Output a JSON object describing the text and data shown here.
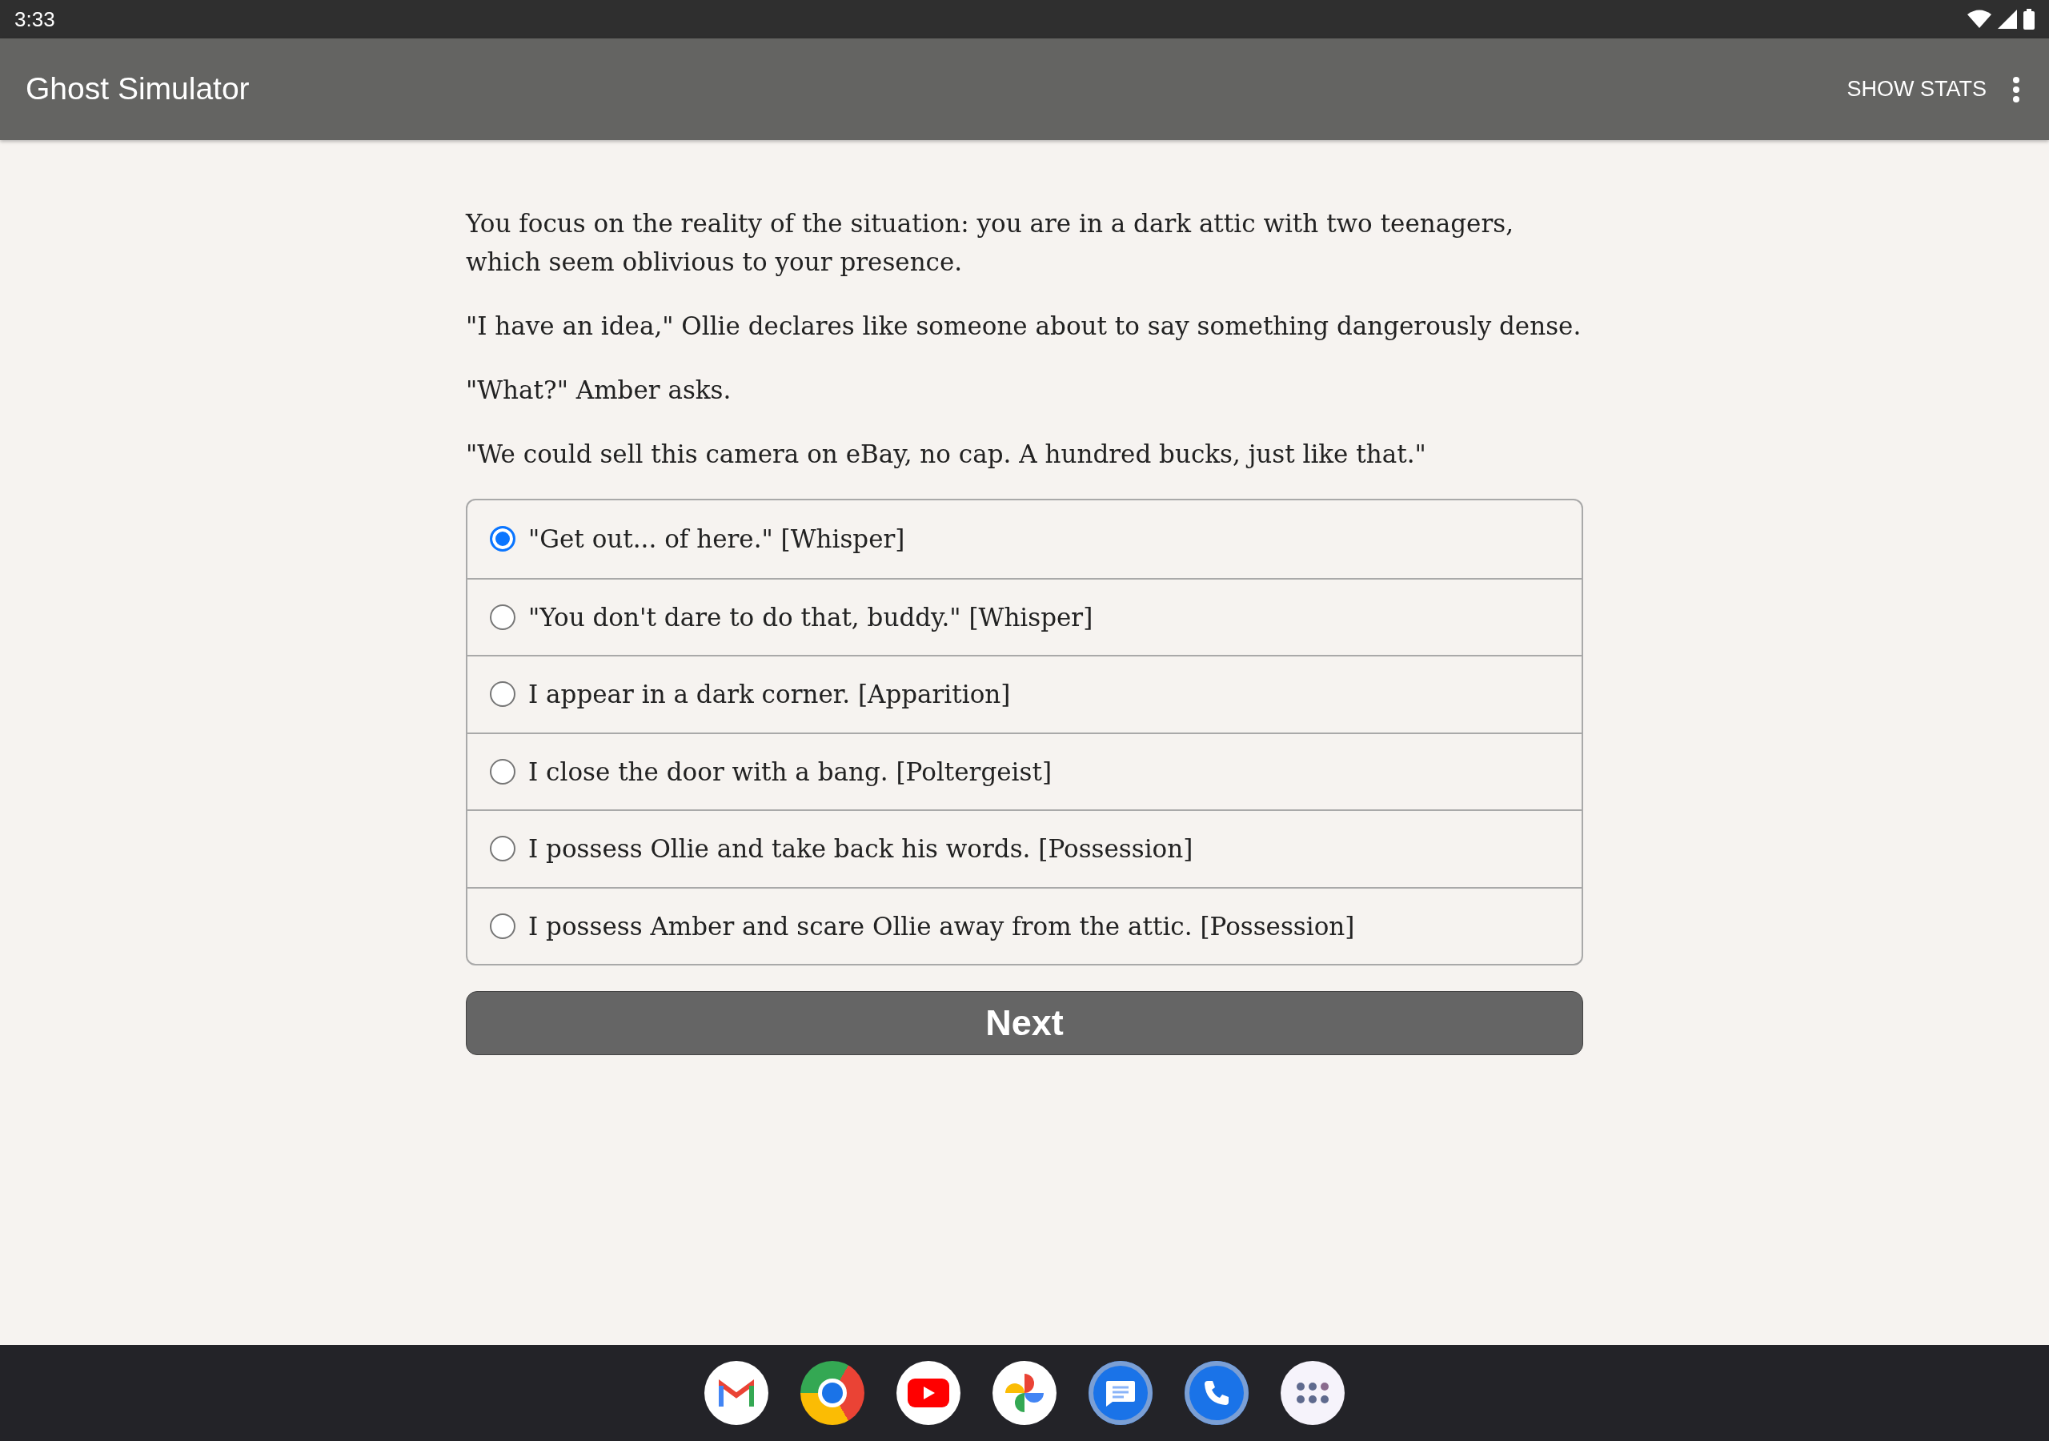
{
  "status_bar": {
    "time": "3:33"
  },
  "app_bar": {
    "title": "Ghost Simulator",
    "action": "SHOW STATS"
  },
  "story": [
    "You focus on the reality of the situation: you are in a dark attic with two teenagers, which seem oblivious to your presence.",
    "\"I have an idea,\" Ollie declares like someone about to say something dangerously dense.",
    "\"What?\" Amber asks.",
    "\"We could sell this camera on eBay, no cap. A hundred bucks, just like that.\""
  ],
  "choices": [
    {
      "label": "\"Get out... of here.\" [Whisper]",
      "selected": true
    },
    {
      "label": "\"You don't dare to do that, buddy.\" [Whisper]",
      "selected": false
    },
    {
      "label": "I appear in a dark corner. [Apparition]",
      "selected": false
    },
    {
      "label": "I close the door with a bang. [Poltergeist]",
      "selected": false
    },
    {
      "label": "I possess Ollie and take back his words. [Possession]",
      "selected": false
    },
    {
      "label": "I possess Amber and scare Ollie away from the attic. [Possession]",
      "selected": false
    }
  ],
  "next_button": "Next"
}
